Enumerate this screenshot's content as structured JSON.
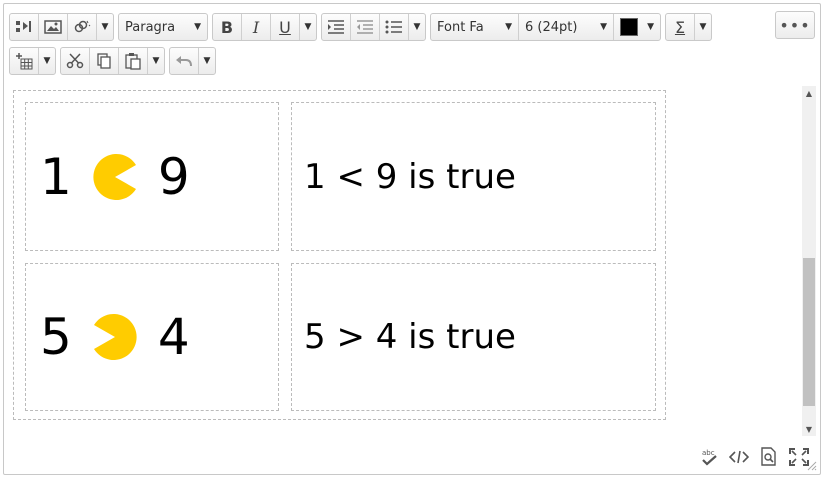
{
  "toolbar": {
    "format_select": "Paragra",
    "font_family_select": "Font Fa",
    "font_size_select": "6 (24pt)",
    "text_color": "#000000",
    "more_label": "•••"
  },
  "table": {
    "rows": [
      {
        "left_a": "1",
        "left_b": "9",
        "mouth": "right",
        "statement": "1 < 9 is true"
      },
      {
        "left_a": "5",
        "left_b": "4",
        "mouth": "left",
        "statement": "5 > 4 is true"
      }
    ]
  },
  "colors": {
    "pacman": "#ffcc00",
    "border": "#c8c8c8"
  },
  "status_icons": [
    "spellcheck-icon",
    "source-code-icon",
    "preview-icon",
    "fullscreen-icon"
  ],
  "scroll": {
    "position": 0.55
  }
}
